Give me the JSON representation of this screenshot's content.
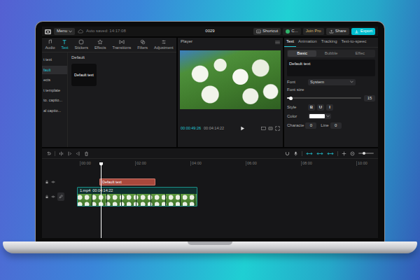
{
  "topbar": {
    "menu": "Menu",
    "autosave": "Auto saved: 14:17:08",
    "project": "0029",
    "shortcut": "Shortcut",
    "user": "C...",
    "join_pro": "Join Pro",
    "share": "Share",
    "export": "Export"
  },
  "media_tabs": [
    {
      "label": "Audio",
      "selected": false
    },
    {
      "label": "Text",
      "selected": true
    },
    {
      "label": "Stickers",
      "selected": false
    },
    {
      "label": "Effects",
      "selected": false
    },
    {
      "label": "Transitions",
      "selected": false
    },
    {
      "label": "Filters",
      "selected": false
    },
    {
      "label": "Adjustment",
      "selected": false
    }
  ],
  "sidebar": {
    "items": [
      {
        "label": "t text",
        "selected": false
      },
      {
        "label": "fault",
        "selected": true
      },
      {
        "label": "ects",
        "selected": false
      },
      {
        "label": "t template",
        "selected": false
      },
      {
        "label": "to. captio...",
        "selected": false
      },
      {
        "label": "al captio...",
        "selected": false
      }
    ]
  },
  "library": {
    "heading": "Default",
    "cards": [
      {
        "label": "Default text"
      }
    ]
  },
  "player": {
    "title": "Player",
    "current": "00:00:49:26",
    "duration": "00:04:14:22"
  },
  "inspector": {
    "tabs": [
      {
        "label": "Text",
        "selected": true
      },
      {
        "label": "Animation",
        "selected": false
      },
      {
        "label": "Tracking",
        "selected": false
      },
      {
        "label": "Text-to-speec",
        "selected": false
      }
    ],
    "subtabs": [
      {
        "label": "Basic",
        "selected": true
      },
      {
        "label": "Bubble",
        "selected": false
      },
      {
        "label": "Effec",
        "selected": false
      }
    ],
    "text_value": "Default text",
    "font": {
      "label": "Font",
      "value": "System"
    },
    "font_size": {
      "label": "Font size",
      "level": 0.05,
      "value": "15"
    },
    "style": {
      "label": "Style",
      "buttons": [
        {
          "label": "B",
          "selected": false
        },
        {
          "label": "U",
          "selected": false
        },
        {
          "label": "I",
          "selected": false
        }
      ]
    },
    "color": {
      "label": "Color",
      "swatch": "#ffffff"
    },
    "spacing": [
      {
        "label": "Characte",
        "value": "0"
      },
      {
        "label": "Line",
        "value": "0"
      }
    ]
  },
  "timeline": {
    "ruler": [
      "00:00",
      "02:00",
      "04:00",
      "06:00",
      "08:00",
      "10:00"
    ],
    "text_clip": {
      "label": "Default text"
    },
    "video_clip": {
      "name": "1.mp4",
      "duration": "00:04:14:22"
    }
  }
}
